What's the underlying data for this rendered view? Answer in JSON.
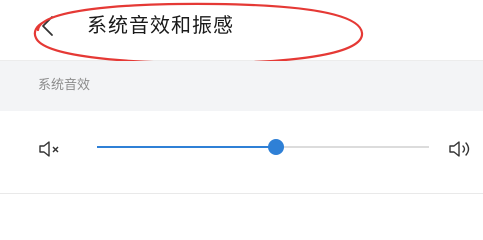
{
  "header": {
    "title": "系统音效和振感",
    "back_icon": "chevron-left-icon"
  },
  "annotation": {
    "color": "#e53935",
    "shape": "hand-drawn-ellipse"
  },
  "section": {
    "label": "系统音效"
  },
  "volume": {
    "mute_icon": "speaker-muted-icon",
    "max_icon": "speaker-volume-icon",
    "level": 0.54,
    "accent_color": "#2f80d6"
  }
}
